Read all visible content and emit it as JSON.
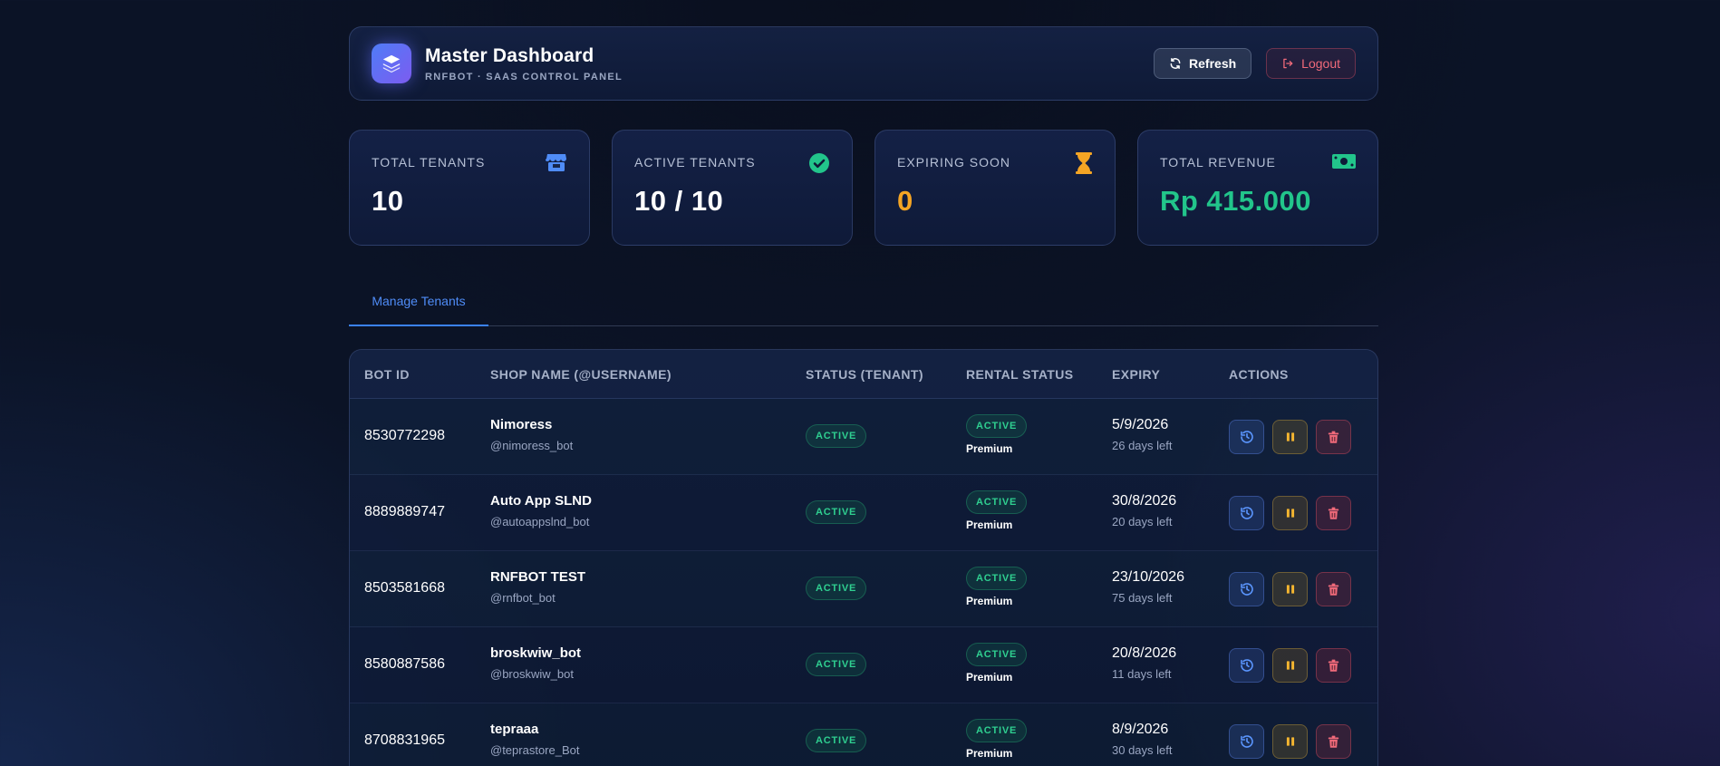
{
  "header": {
    "title": "Master Dashboard",
    "subtitle": "RNFBOT · SAAS CONTROL PANEL",
    "logo_icon": "layers-icon",
    "refresh_label": "Refresh",
    "logout_label": "Logout"
  },
  "stats": [
    {
      "label": "TOTAL TENANTS",
      "value": "10",
      "icon": "store-icon",
      "color": "#ffffff",
      "icon_color": "#4f8cf7"
    },
    {
      "label": "ACTIVE TENANTS",
      "value": "10 / 10",
      "icon": "check-circle-icon",
      "color": "#ffffff",
      "icon_color": "#22c58b"
    },
    {
      "label": "EXPIRING SOON",
      "value": "0",
      "icon": "hourglass-icon",
      "color": "#f5a524",
      "icon_color": "#f5a524"
    },
    {
      "label": "TOTAL REVENUE",
      "value": "Rp 415.000",
      "icon": "money-icon",
      "color": "#22c58b",
      "icon_color": "#22c58b"
    }
  ],
  "tabs": [
    {
      "label": "Manage Tenants",
      "active": true
    }
  ],
  "table": {
    "headers": [
      "BOT ID",
      "SHOP NAME (@USERNAME)",
      "STATUS (TENANT)",
      "RENTAL STATUS",
      "EXPIRY",
      "ACTIONS"
    ],
    "rows": [
      {
        "bot_id": "8530772298",
        "shop": "Nimoress",
        "username": "@nimoress_bot",
        "status": "ACTIVE",
        "rental": "ACTIVE",
        "plan": "Premium",
        "expiry": "5/9/2026",
        "left": "26 days left"
      },
      {
        "bot_id": "8889889747",
        "shop": "Auto App SLND",
        "username": "@autoappslnd_bot",
        "status": "ACTIVE",
        "rental": "ACTIVE",
        "plan": "Premium",
        "expiry": "30/8/2026",
        "left": "20 days left"
      },
      {
        "bot_id": "8503581668",
        "shop": "RNFBOT TEST",
        "username": "@rnfbot_bot",
        "status": "ACTIVE",
        "rental": "ACTIVE",
        "plan": "Premium",
        "expiry": "23/10/2026",
        "left": "75 days left"
      },
      {
        "bot_id": "8580887586",
        "shop": "broskwiw_bot",
        "username": "@broskwiw_bot",
        "status": "ACTIVE",
        "rental": "ACTIVE",
        "plan": "Premium",
        "expiry": "20/8/2026",
        "left": "11 days left"
      },
      {
        "bot_id": "8708831965",
        "shop": "tepraaa",
        "username": "@teprastore_Bot",
        "status": "ACTIVE",
        "rental": "ACTIVE",
        "plan": "Premium",
        "expiry": "8/9/2026",
        "left": "30 days left"
      }
    ],
    "action_icons": [
      "history-icon",
      "pause-icon",
      "trash-icon"
    ]
  }
}
